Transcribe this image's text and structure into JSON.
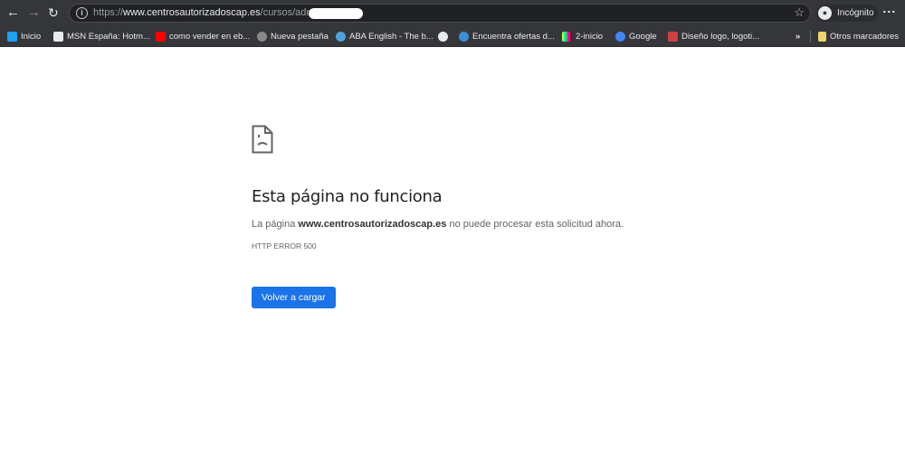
{
  "browser": {
    "url_scheme": "https://",
    "url_host": "www.centrosautorizadoscap.es",
    "url_path": "/cursos/admin",
    "profile_label": "Incógnito",
    "icons": [
      "back-arrow-icon",
      "forward-arrow-icon",
      "reload-icon",
      "info-icon",
      "star-icon",
      "incognito-icon",
      "menu-icon"
    ]
  },
  "bookmarks": [
    {
      "label": "Inicio",
      "icon": "twitter-icon",
      "color": "#1da1f2"
    },
    {
      "label": "MSN España: Hotm...",
      "icon": "msn-icon",
      "color": "#e8eaed"
    },
    {
      "label": "como vender en eb...",
      "icon": "youtube-icon",
      "color": "#ff0000"
    },
    {
      "label": "Nueva pestaña",
      "icon": "tab-icon",
      "color": "#888888"
    },
    {
      "label": "ABA English - The b...",
      "icon": "aba-icon",
      "color": "#4fa3d8"
    },
    {
      "label": "",
      "icon": "globe-icon",
      "color": "#e8eaed"
    },
    {
      "label": "Encuentra ofertas d...",
      "icon": "edge-icon",
      "color": "#3c8dd8"
    },
    {
      "label": "2-inicio",
      "icon": "color-bars-icon",
      "color": "#ff00ff"
    },
    {
      "label": "Google",
      "icon": "google-icon",
      "color": "#4285f4"
    },
    {
      "label": "Diseño logo, logoti...",
      "icon": "logo-icon",
      "color": "#d04040"
    }
  ],
  "overflow_label": "»",
  "other_bookmarks": "Otros marcadores",
  "error": {
    "title": "Esta página no funciona",
    "desc_prefix": "La página ",
    "desc_host": "www.centrosautorizadoscap.es",
    "desc_suffix": " no puede procesar esta solicitud ahora.",
    "code": "HTTP ERROR 500",
    "reload_button": "Volver a cargar",
    "accent": "#1a73e8"
  }
}
